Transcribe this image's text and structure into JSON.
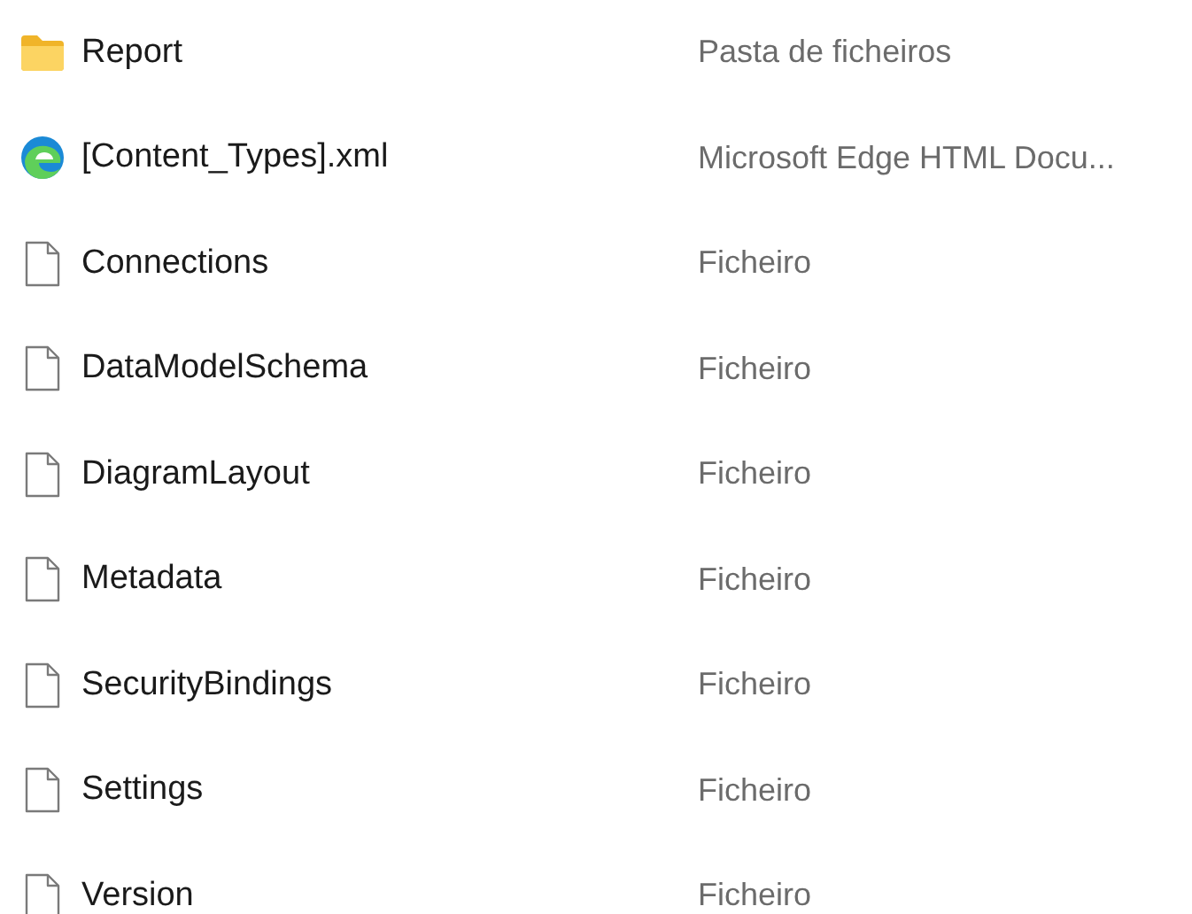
{
  "files": [
    {
      "name": "Report",
      "type": "Pasta de ficheiros",
      "kind": "folder"
    },
    {
      "name": "[Content_Types].xml",
      "type": "Microsoft Edge HTML Docu...",
      "kind": "edge"
    },
    {
      "name": "Connections",
      "type": "Ficheiro",
      "kind": "file"
    },
    {
      "name": "DataModelSchema",
      "type": "Ficheiro",
      "kind": "file"
    },
    {
      "name": "DiagramLayout",
      "type": "Ficheiro",
      "kind": "file"
    },
    {
      "name": "Metadata",
      "type": "Ficheiro",
      "kind": "file"
    },
    {
      "name": "SecurityBindings",
      "type": "Ficheiro",
      "kind": "file"
    },
    {
      "name": "Settings",
      "type": "Ficheiro",
      "kind": "file"
    },
    {
      "name": "Version",
      "type": "Ficheiro",
      "kind": "file"
    }
  ]
}
